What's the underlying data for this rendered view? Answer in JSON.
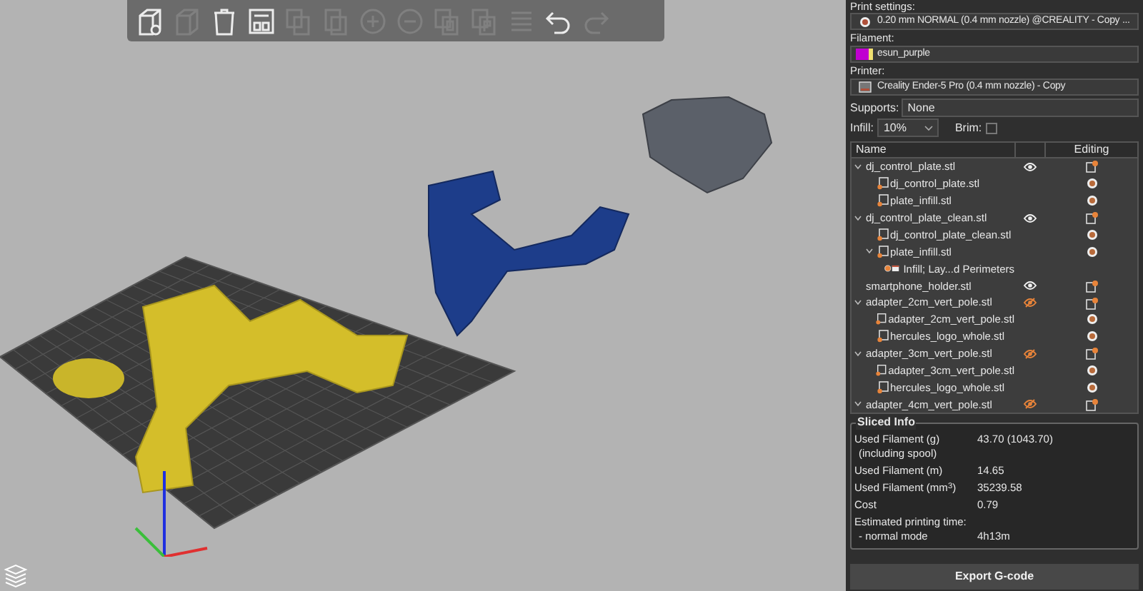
{
  "toolbar": [
    {
      "kind": "add-object",
      "disabled": false
    },
    {
      "kind": "cube",
      "disabled": true
    },
    {
      "kind": "delete",
      "disabled": false
    },
    {
      "kind": "arrange",
      "disabled": false
    },
    {
      "kind": "copy",
      "disabled": true
    },
    {
      "kind": "paste",
      "disabled": true
    },
    {
      "kind": "add",
      "disabled": true
    },
    {
      "kind": "remove",
      "disabled": true
    },
    {
      "kind": "split-objects",
      "disabled": true
    },
    {
      "kind": "split-parts",
      "disabled": true
    },
    {
      "kind": "layers",
      "disabled": true
    },
    {
      "kind": "undo",
      "disabled": false
    },
    {
      "kind": "redo",
      "disabled": true
    }
  ],
  "sidebar": {
    "print_settings": {
      "label": "Print settings:",
      "value": "0.20 mm NORMAL (0.4 mm nozzle) @CREALITY - Copy ..."
    },
    "filament": {
      "label": "Filament:",
      "value": "esun_purple",
      "color": "#c000d0"
    },
    "printer": {
      "label": "Printer:",
      "value": "Creality Ender-5 Pro (0.4 mm nozzle) - Copy"
    },
    "supports": {
      "label": "Supports:",
      "value": "None"
    },
    "infill": {
      "label": "Infill:",
      "value": "10%"
    },
    "brim": {
      "label": "Brim:",
      "checked": false
    },
    "object_list": {
      "columns": [
        "Name",
        "Editing"
      ],
      "items": [
        {
          "kind": "object",
          "name": "dj_control_plate.stl",
          "expanded": true,
          "visible": true,
          "children": [
            {
              "kind": "part",
              "name": "dj_control_plate.stl"
            },
            {
              "kind": "part",
              "name": "plate_infill.stl"
            }
          ]
        },
        {
          "kind": "object",
          "name": "dj_control_plate_clean.stl",
          "expanded": true,
          "visible": true,
          "children": [
            {
              "kind": "part",
              "name": "dj_control_plate_clean.stl"
            },
            {
              "kind": "part",
              "name": "plate_infill.stl",
              "expanded": true,
              "children": [
                {
                  "kind": "setting",
                  "name": "Infill; Lay...d Perimeters"
                }
              ]
            }
          ]
        },
        {
          "kind": "object",
          "name": "smartphone_holder.stl",
          "visible": true
        },
        {
          "kind": "object",
          "name": "adapter_2cm_vert_pole.stl",
          "expanded": true,
          "visible": false,
          "children": [
            {
              "kind": "part",
              "name": "adapter_2cm_vert_pole.stl"
            },
            {
              "kind": "part",
              "name": "hercules_logo_whole.stl"
            }
          ]
        },
        {
          "kind": "object",
          "name": "adapter_3cm_vert_pole.stl",
          "expanded": true,
          "visible": false,
          "children": [
            {
              "kind": "part",
              "name": "adapter_3cm_vert_pole.stl"
            },
            {
              "kind": "part",
              "name": "hercules_logo_whole.stl"
            }
          ]
        },
        {
          "kind": "object",
          "name": "adapter_4cm_vert_pole.stl",
          "expanded": true,
          "visible": false
        }
      ]
    },
    "sliced_info": {
      "title": "Sliced Info",
      "rows": [
        {
          "label": "Used Filament (g)",
          "sublabel": "(including spool)",
          "value": "43.70 (1043.70)"
        },
        {
          "label": "Used Filament (m)",
          "value": "14.65"
        },
        {
          "label": "Used Filament (mm$^{3}$)",
          "value": "35239.58"
        },
        {
          "label": "Cost",
          "value": "0.79"
        },
        {
          "label": "Estimated printing time:",
          "sublabel": "- normal mode",
          "value": "4h13m"
        }
      ]
    },
    "export_button": "Export G-code"
  }
}
